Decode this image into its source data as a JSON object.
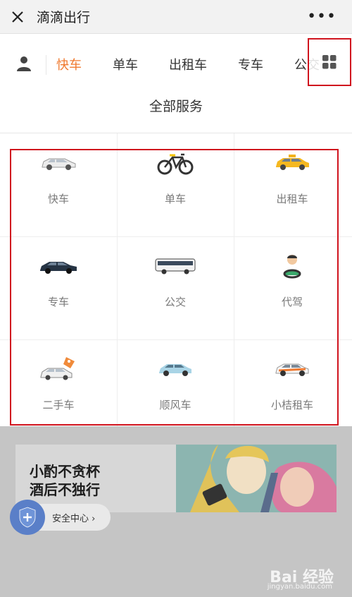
{
  "header": {
    "title": "滴滴出行",
    "close_icon": "close-icon",
    "more_label": "•••"
  },
  "tabs": [
    {
      "label": "快车",
      "active": true
    },
    {
      "label": "单车",
      "active": false
    },
    {
      "label": "出租车",
      "active": false
    },
    {
      "label": "专车",
      "active": false
    },
    {
      "label": "公交",
      "active": false
    }
  ],
  "section_title": "全部服务",
  "services": [
    {
      "label": "快车",
      "icon": "car-icon"
    },
    {
      "label": "单车",
      "icon": "bicycle-icon"
    },
    {
      "label": "出租车",
      "icon": "taxi-icon"
    },
    {
      "label": "专车",
      "icon": "premier-car-icon"
    },
    {
      "label": "公交",
      "icon": "bus-icon"
    },
    {
      "label": "代驾",
      "icon": "driver-icon"
    },
    {
      "label": "二手车",
      "icon": "used-car-icon"
    },
    {
      "label": "顺风车",
      "icon": "hitch-car-icon"
    },
    {
      "label": "小桔租车",
      "icon": "rental-car-icon"
    }
  ],
  "banner": {
    "line1": "小酌不贪杯",
    "line2": "酒后不独行"
  },
  "safety": {
    "label": "安全中心",
    "chevron": "›"
  },
  "watermark": {
    "main": "Bai 经验",
    "sub": "jingyan.baidu.com"
  },
  "colors": {
    "accent": "#f07a30",
    "highlight_border": "#d0141e",
    "safety_blue": "#5a7fc8"
  }
}
